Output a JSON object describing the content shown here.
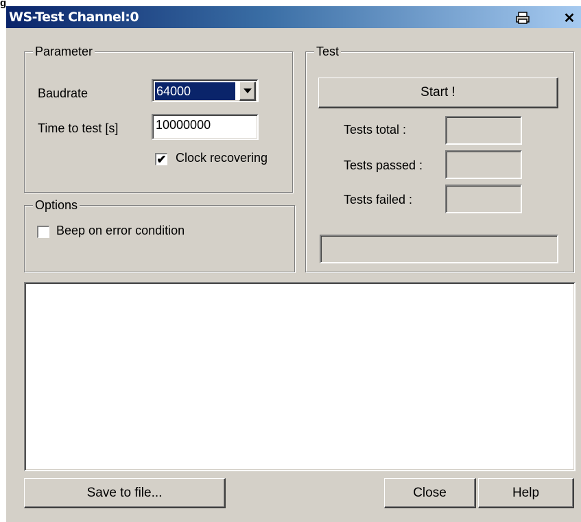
{
  "window": {
    "title": "WS-Test Channel:0"
  },
  "parameter": {
    "legend": "Parameter",
    "baudrate_label": "Baudrate",
    "baudrate_value": "64000",
    "time_label": "Time to test [s]",
    "time_value": "10000000",
    "clock_recovering_label": "Clock recovering",
    "clock_recovering_checked": true
  },
  "options": {
    "legend": "Options",
    "beep_label": "Beep on error condition",
    "beep_checked": false
  },
  "test": {
    "legend": "Test",
    "start_label": "Start !",
    "tests_total_label": "Tests total :",
    "tests_passed_label": "Tests passed :",
    "tests_failed_label": "Tests failed :"
  },
  "buttons": {
    "save_label": "Save to file...",
    "close_label": "Close",
    "help_label": "Help"
  },
  "colors": {
    "titlebar_start": "#0a246a",
    "titlebar_end": "#a6caf0",
    "face": "#d4d0c8",
    "selection": "#0a246a"
  },
  "icons": {
    "titlebar_left": "print-icon",
    "titlebar_right": "close-icon",
    "dropdown": "chevron-down-icon",
    "check": "checkmark-icon"
  }
}
